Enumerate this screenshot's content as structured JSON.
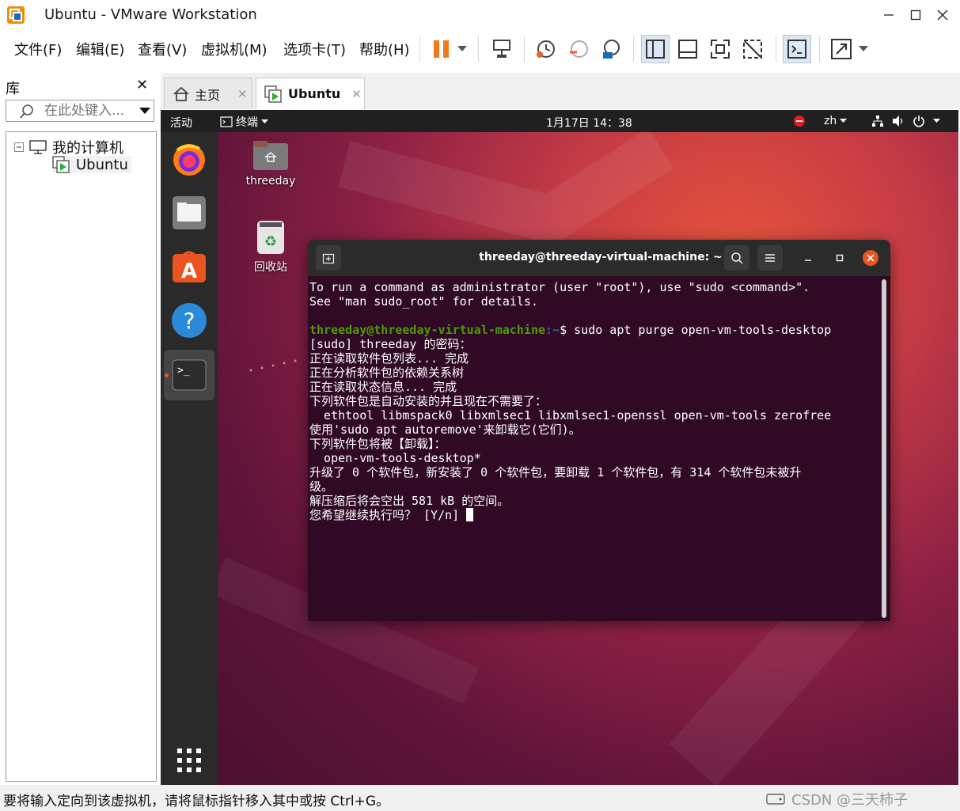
{
  "window": {
    "title": "Ubuntu - VMware Workstation"
  },
  "menu": [
    "文件(F)",
    "编辑(E)",
    "查看(V)",
    "虚拟机(M)",
    "选项卡(T)",
    "帮助(H)"
  ],
  "library": {
    "title": "库",
    "search_placeholder": "在此处键入...",
    "tree": {
      "root": "我的计算机",
      "child": "Ubuntu"
    }
  },
  "tabs": [
    {
      "label": "主页"
    },
    {
      "label": "Ubuntu"
    }
  ],
  "ubuntu": {
    "activities": "活动",
    "app_menu": "终端",
    "clock": "1月17日 14：38",
    "lang": "zh",
    "desktop_icons": [
      "threeday",
      "回收站"
    ]
  },
  "terminal": {
    "title": "threeday@threeday-virtual-machine: ~",
    "lines": [
      "To run a command as administrator (user \"root\"), use \"sudo <command>\".",
      "See \"man sudo_root\" for details.",
      "",
      "[sudo] threeday 的密码：",
      "正在读取软件包列表... 完成",
      "正在分析软件包的依赖关系树",
      "正在读取状态信息... 完成",
      "下列软件包是自动安装的并且现在不需要了：",
      "  ethtool libmspack0 libxmlsec1 libxmlsec1-openssl open-vm-tools zerofree",
      "使用'sudo apt autoremove'来卸载它(它们)。",
      "下列软件包将被【卸载】：",
      "  open-vm-tools-desktop*",
      "升级了 0 个软件包，新安装了 0 个软件包，要卸载 1 个软件包，有 314 个软件包未被升",
      "级。",
      "解压缩后将会空出 581 kB 的空间。"
    ],
    "prompt_user": "threeday@threeday-virtual-machine",
    "prompt_path": ":~",
    "prompt_cmd": "$ sudo apt purge open-vm-tools-desktop",
    "last_line": "您希望继续执行吗？ [Y/n] "
  },
  "status": {
    "text": "要将输入定向到该虚拟机，请将鼠标指针移入其中或按 Ctrl+G。",
    "watermark": "CSDN @三天柿子"
  },
  "colors": {
    "accent": "#e95420",
    "prompt_user": "#4e9a06",
    "prompt_path": "#3465a4",
    "terminal_bg": "#300a24"
  }
}
